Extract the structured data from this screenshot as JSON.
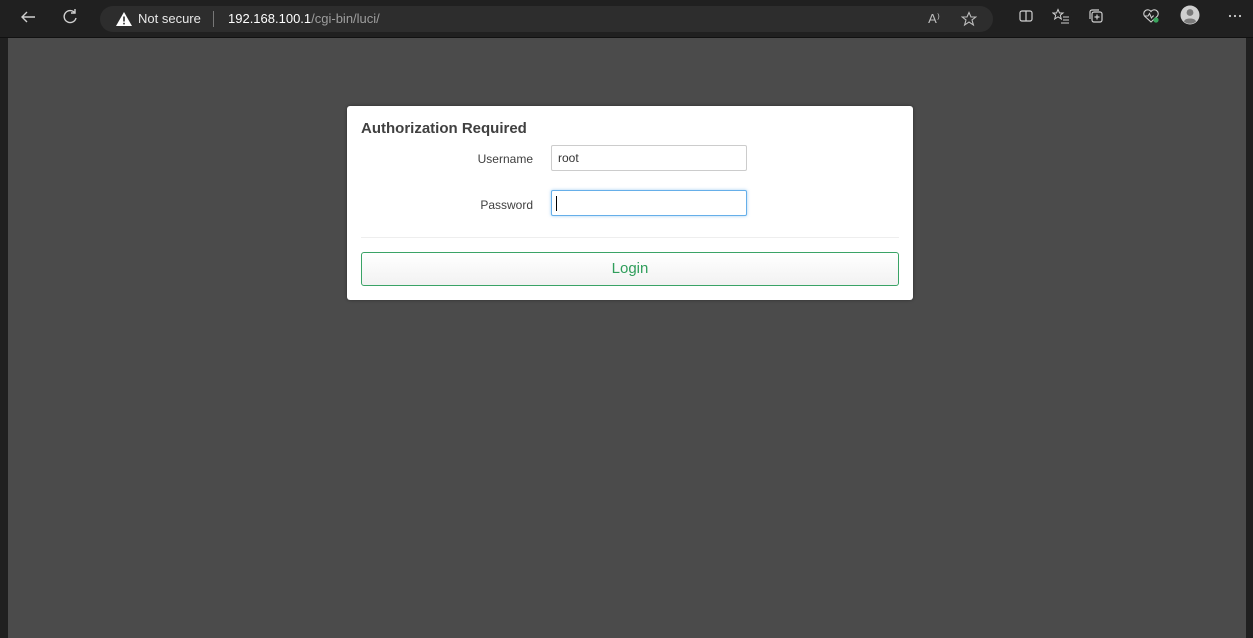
{
  "browser": {
    "security_label": "Not secure",
    "url_host": "192.168.100.1",
    "url_path": "/cgi-bin/luci/",
    "icons": {
      "back": "back-arrow-icon",
      "refresh": "refresh-icon",
      "warning": "warning-icon",
      "read_aloud": "read-aloud-icon",
      "favorite": "star-icon",
      "split_screen": "split-screen-icon",
      "favorites": "favorites-list-icon",
      "collections": "collections-icon",
      "browser_essentials": "heart-pulse-icon",
      "profile": "profile-avatar-icon",
      "more": "more-icon"
    },
    "read_aloud_label": "A⁾"
  },
  "login": {
    "title": "Authorization Required",
    "username_label": "Username",
    "username_value": "root",
    "password_label": "Password",
    "password_value": "",
    "button_label": "Login"
  },
  "colors": {
    "page_background": "#4b4b4b",
    "button_accent": "#2f9e5b",
    "focus_border": "#66afe9",
    "warning": "#ffffff"
  }
}
